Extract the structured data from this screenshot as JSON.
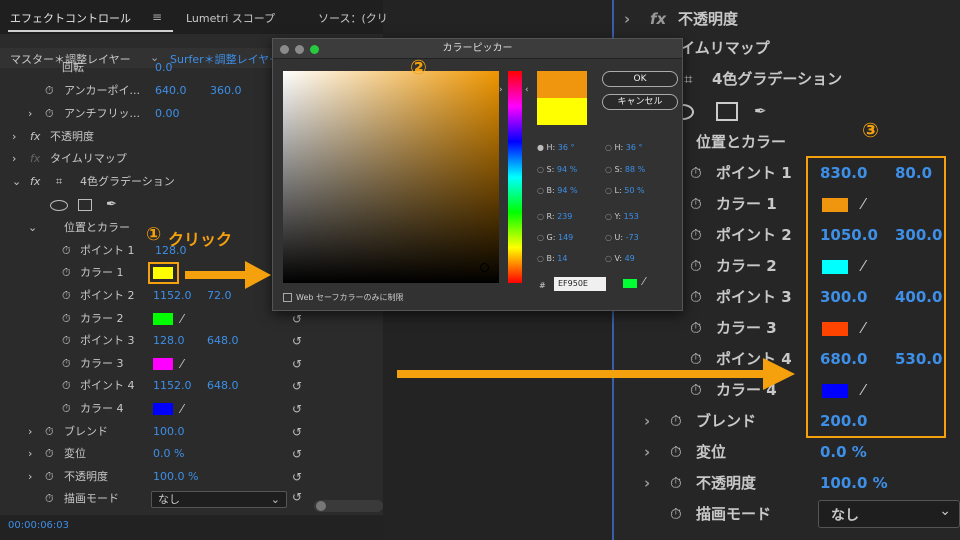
{
  "left": {
    "tabs": [
      "エフェクトコントロール",
      "Lumetri スコープ",
      "ソース：(クリ"
    ],
    "breadcrumb": {
      "master": "マスター＊調整レイヤー",
      "clip": "Surfer＊調整レイヤー"
    },
    "rows": {
      "rotate": "回転",
      "rotate_val": "0.0",
      "anchor": "アンカーポイ...",
      "anchor_x": "640.0",
      "anchor_y": "360.0",
      "flicker": "アンチフリッ...",
      "flicker_val": "0.00",
      "opacity": "不透明度",
      "remap": "タイムリマップ",
      "grad": "4色グラデーション",
      "poscolor": "位置とカラー",
      "p1": "ポイント 1",
      "p1x": "128.0",
      "p1y": "72.0",
      "c1": "カラー 1",
      "p2": "ポイント 2",
      "p2x": "1152.0",
      "p2y": "72.0",
      "c2": "カラー 2",
      "p3": "ポイント 3",
      "p3x": "128.0",
      "p3y": "648.0",
      "c3": "カラー 3",
      "p4": "ポイント 4",
      "p4x": "1152.0",
      "p4y": "648.0",
      "c4": "カラー 4",
      "blend": "ブレンド",
      "blend_val": "100.0",
      "jitter": "変位",
      "jitter_val": "0.0 %",
      "op2": "不透明度",
      "op2_val": "100.0 %",
      "mode": "描画モード",
      "mode_val": "なし"
    },
    "fx": "fx",
    "timecode": "00:00:06:03",
    "colors": {
      "c1": "#ffff00",
      "c2": "#00ff00",
      "c3": "#ff00ff",
      "c4": "#0000ff"
    }
  },
  "dialog": {
    "title": "カラーピッカー",
    "ok": "OK",
    "cancel": "キャンセル",
    "web_safe": "Web セーフカラーのみに制限",
    "hex_label": "#",
    "hex": "EF950E",
    "fields": {
      "h1": "H:",
      "h1v": "36 °",
      "s1": "S:",
      "s1v": "94 %",
      "b1": "B:",
      "b1v": "94 %",
      "h2": "H:",
      "h2v": "36 °",
      "s2": "S:",
      "s2v": "88 %",
      "l2": "L:",
      "l2v": "50 %",
      "r": "R:",
      "rv": "239",
      "y": "Y:",
      "yv": "153",
      "g": "G:",
      "gv": "149",
      "u": "U:",
      "uv": "-73",
      "b": "B:",
      "bv": "14",
      "v": "V:",
      "vv": "49"
    },
    "new_color": "#ef950e",
    "old_color": "#ffff00"
  },
  "right": {
    "opacity": "不透明度",
    "remap": "イムリマップ",
    "grad": "4色グラデーション",
    "poscolor": "位置とカラー",
    "p1": "ポイント 1",
    "p1x": "830.0",
    "p1y": "80.0",
    "c1": "カラー 1",
    "p2": "ポイント 2",
    "p2x": "1050.0",
    "p2y": "300.0",
    "c2": "カラー 2",
    "p3": "ポイント 3",
    "p3x": "300.0",
    "p3y": "400.0",
    "c3": "カラー 3",
    "p4": "ポイント 4",
    "p4x": "680.0",
    "p4y": "530.0",
    "c4": "カラー 4",
    "blend": "ブレンド",
    "blend_val": "200.0",
    "jitter": "変位",
    "jitter_val": "0.0 %",
    "op2": "不透明度",
    "op2_val": "100.0 %",
    "mode": "描画モード",
    "mode_val": "なし",
    "colors": {
      "c1": "#ef950e",
      "c2": "#00ffff",
      "c3": "#ff4400",
      "c4": "#0000ff"
    }
  },
  "annotations": {
    "step1": "①",
    "step1_text": "クリック",
    "step2": "②",
    "step3": "③",
    "accent": "#f5a10e"
  }
}
